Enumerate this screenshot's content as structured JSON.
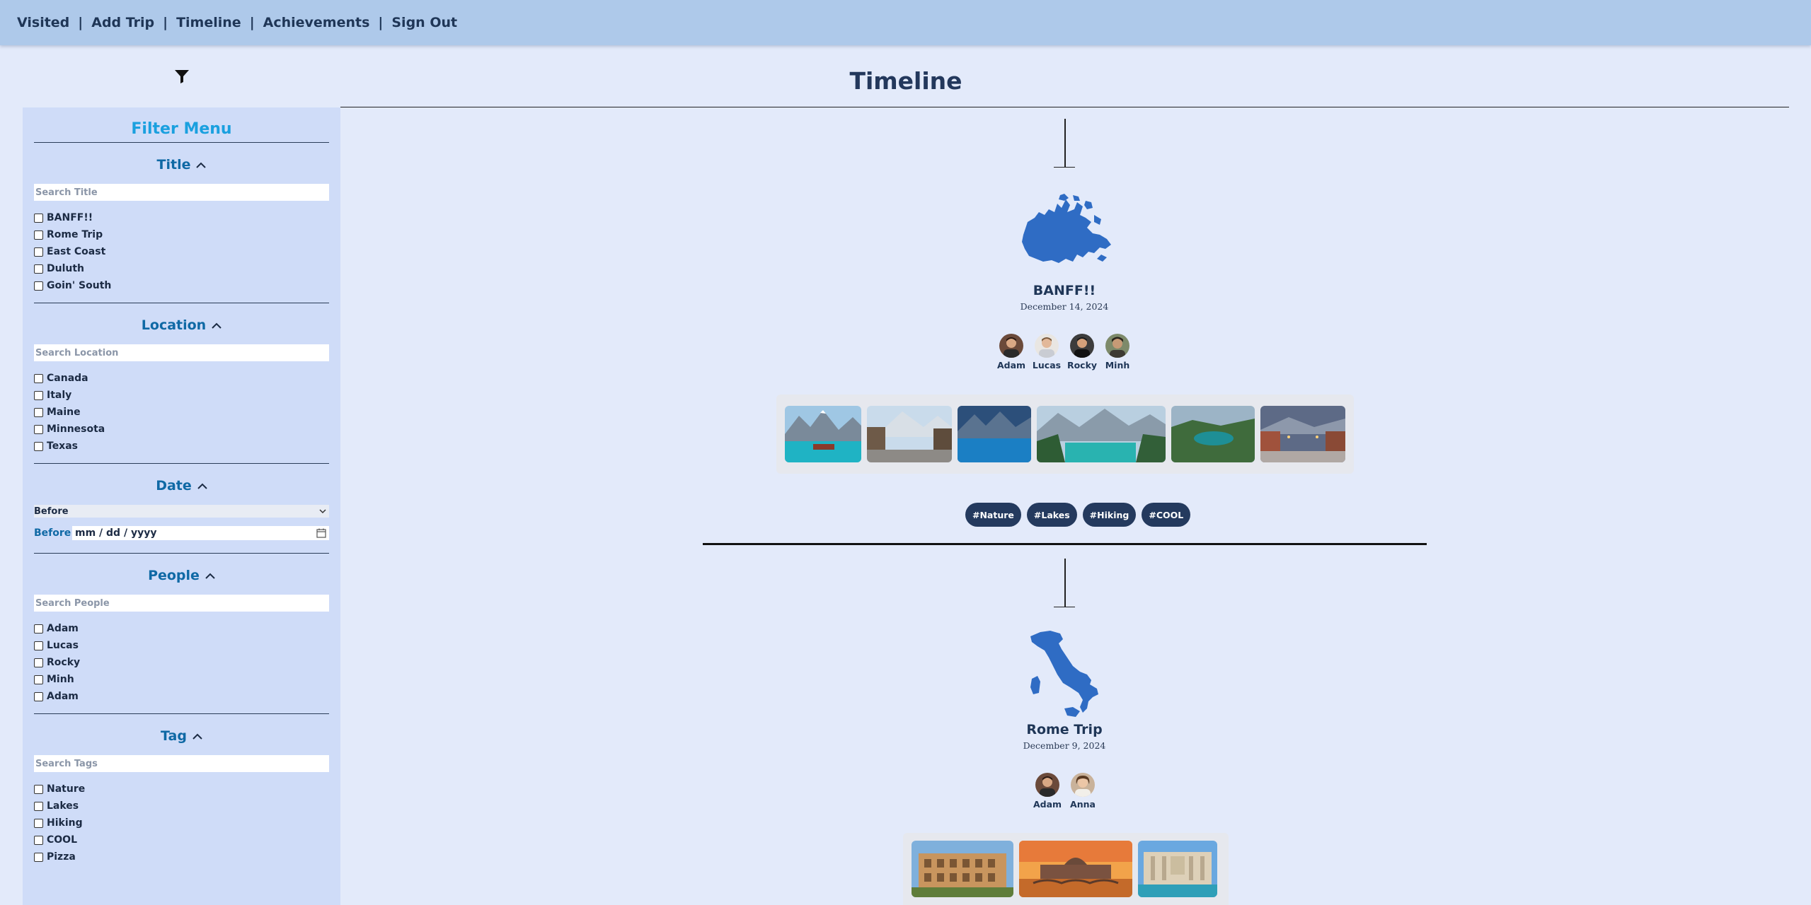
{
  "nav": {
    "links": [
      "Visited",
      "Add Trip",
      "Timeline",
      "Achievements",
      "Sign Out"
    ]
  },
  "filter_icon": "filter-funnel-icon",
  "sidebar": {
    "title": "Filter Menu",
    "title_section": {
      "heading": "Title",
      "placeholder": "Search Title",
      "items": [
        "BANFF!!",
        "Rome Trip",
        "East Coast",
        "Duluth",
        "Goin' South"
      ]
    },
    "location_section": {
      "heading": "Location",
      "placeholder": "Search Location",
      "items": [
        "Canada",
        "Italy",
        "Maine",
        "Minnesota",
        "Texas"
      ]
    },
    "date_section": {
      "heading": "Date",
      "select_value": "Before",
      "label": "Before",
      "date_placeholder": "mm / dd / yyyy"
    },
    "people_section": {
      "heading": "People",
      "placeholder": "Search People",
      "items": [
        "Adam",
        "Lucas",
        "Rocky",
        "Minh",
        "Adam"
      ]
    },
    "tag_section": {
      "heading": "Tag",
      "placeholder": "Search Tags",
      "items": [
        "Nature",
        "Lakes",
        "Hiking",
        "COOL",
        "Pizza"
      ]
    }
  },
  "main": {
    "title": "Timeline",
    "trips": [
      {
        "title": "BANFF!!",
        "date": "December 14, 2024",
        "map": "canada-map",
        "people": [
          "Adam",
          "Lucas",
          "Rocky",
          "Minh"
        ],
        "tags": [
          "#Nature",
          "#Lakes",
          "#Hiking",
          "#COOL"
        ]
      },
      {
        "title": "Rome Trip",
        "date": "December 9, 2024",
        "map": "italy-map",
        "people": [
          "Adam",
          "Anna"
        ]
      }
    ]
  },
  "colors": {
    "nav_bg": "#aec9ea",
    "page_bg": "#e3eafa",
    "sidebar_bg": "#cfdcf8",
    "filter_title": "#1aa0df",
    "section_heading": "#0f69a5",
    "map_blue": "#2f6cc4",
    "tag_bg": "#243a5e"
  }
}
